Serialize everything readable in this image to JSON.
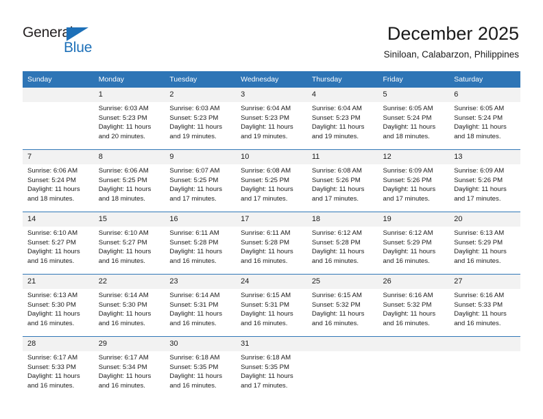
{
  "brand": {
    "name_part1": "General",
    "name_part2": "Blue",
    "accent_color": "#1d70b8"
  },
  "header": {
    "title": "December 2025",
    "subtitle": "Siniloan, Calabarzon, Philippines"
  },
  "theme": {
    "header_row_color": "#2e75b6",
    "daynum_band_color": "#f2f2f2",
    "separator_color": "#2e75b6"
  },
  "weekdays": [
    "Sunday",
    "Monday",
    "Tuesday",
    "Wednesday",
    "Thursday",
    "Friday",
    "Saturday"
  ],
  "weeks": [
    [
      {
        "day": "",
        "sunrise": "",
        "sunset": "",
        "daylight": ""
      },
      {
        "day": "1",
        "sunrise": "Sunrise: 6:03 AM",
        "sunset": "Sunset: 5:23 PM",
        "daylight": "Daylight: 11 hours and 20 minutes."
      },
      {
        "day": "2",
        "sunrise": "Sunrise: 6:03 AM",
        "sunset": "Sunset: 5:23 PM",
        "daylight": "Daylight: 11 hours and 19 minutes."
      },
      {
        "day": "3",
        "sunrise": "Sunrise: 6:04 AM",
        "sunset": "Sunset: 5:23 PM",
        "daylight": "Daylight: 11 hours and 19 minutes."
      },
      {
        "day": "4",
        "sunrise": "Sunrise: 6:04 AM",
        "sunset": "Sunset: 5:23 PM",
        "daylight": "Daylight: 11 hours and 19 minutes."
      },
      {
        "day": "5",
        "sunrise": "Sunrise: 6:05 AM",
        "sunset": "Sunset: 5:24 PM",
        "daylight": "Daylight: 11 hours and 18 minutes."
      },
      {
        "day": "6",
        "sunrise": "Sunrise: 6:05 AM",
        "sunset": "Sunset: 5:24 PM",
        "daylight": "Daylight: 11 hours and 18 minutes."
      }
    ],
    [
      {
        "day": "7",
        "sunrise": "Sunrise: 6:06 AM",
        "sunset": "Sunset: 5:24 PM",
        "daylight": "Daylight: 11 hours and 18 minutes."
      },
      {
        "day": "8",
        "sunrise": "Sunrise: 6:06 AM",
        "sunset": "Sunset: 5:25 PM",
        "daylight": "Daylight: 11 hours and 18 minutes."
      },
      {
        "day": "9",
        "sunrise": "Sunrise: 6:07 AM",
        "sunset": "Sunset: 5:25 PM",
        "daylight": "Daylight: 11 hours and 17 minutes."
      },
      {
        "day": "10",
        "sunrise": "Sunrise: 6:08 AM",
        "sunset": "Sunset: 5:25 PM",
        "daylight": "Daylight: 11 hours and 17 minutes."
      },
      {
        "day": "11",
        "sunrise": "Sunrise: 6:08 AM",
        "sunset": "Sunset: 5:26 PM",
        "daylight": "Daylight: 11 hours and 17 minutes."
      },
      {
        "day": "12",
        "sunrise": "Sunrise: 6:09 AM",
        "sunset": "Sunset: 5:26 PM",
        "daylight": "Daylight: 11 hours and 17 minutes."
      },
      {
        "day": "13",
        "sunrise": "Sunrise: 6:09 AM",
        "sunset": "Sunset: 5:26 PM",
        "daylight": "Daylight: 11 hours and 17 minutes."
      }
    ],
    [
      {
        "day": "14",
        "sunrise": "Sunrise: 6:10 AM",
        "sunset": "Sunset: 5:27 PM",
        "daylight": "Daylight: 11 hours and 16 minutes."
      },
      {
        "day": "15",
        "sunrise": "Sunrise: 6:10 AM",
        "sunset": "Sunset: 5:27 PM",
        "daylight": "Daylight: 11 hours and 16 minutes."
      },
      {
        "day": "16",
        "sunrise": "Sunrise: 6:11 AM",
        "sunset": "Sunset: 5:28 PM",
        "daylight": "Daylight: 11 hours and 16 minutes."
      },
      {
        "day": "17",
        "sunrise": "Sunrise: 6:11 AM",
        "sunset": "Sunset: 5:28 PM",
        "daylight": "Daylight: 11 hours and 16 minutes."
      },
      {
        "day": "18",
        "sunrise": "Sunrise: 6:12 AM",
        "sunset": "Sunset: 5:28 PM",
        "daylight": "Daylight: 11 hours and 16 minutes."
      },
      {
        "day": "19",
        "sunrise": "Sunrise: 6:12 AM",
        "sunset": "Sunset: 5:29 PM",
        "daylight": "Daylight: 11 hours and 16 minutes."
      },
      {
        "day": "20",
        "sunrise": "Sunrise: 6:13 AM",
        "sunset": "Sunset: 5:29 PM",
        "daylight": "Daylight: 11 hours and 16 minutes."
      }
    ],
    [
      {
        "day": "21",
        "sunrise": "Sunrise: 6:13 AM",
        "sunset": "Sunset: 5:30 PM",
        "daylight": "Daylight: 11 hours and 16 minutes."
      },
      {
        "day": "22",
        "sunrise": "Sunrise: 6:14 AM",
        "sunset": "Sunset: 5:30 PM",
        "daylight": "Daylight: 11 hours and 16 minutes."
      },
      {
        "day": "23",
        "sunrise": "Sunrise: 6:14 AM",
        "sunset": "Sunset: 5:31 PM",
        "daylight": "Daylight: 11 hours and 16 minutes."
      },
      {
        "day": "24",
        "sunrise": "Sunrise: 6:15 AM",
        "sunset": "Sunset: 5:31 PM",
        "daylight": "Daylight: 11 hours and 16 minutes."
      },
      {
        "day": "25",
        "sunrise": "Sunrise: 6:15 AM",
        "sunset": "Sunset: 5:32 PM",
        "daylight": "Daylight: 11 hours and 16 minutes."
      },
      {
        "day": "26",
        "sunrise": "Sunrise: 6:16 AM",
        "sunset": "Sunset: 5:32 PM",
        "daylight": "Daylight: 11 hours and 16 minutes."
      },
      {
        "day": "27",
        "sunrise": "Sunrise: 6:16 AM",
        "sunset": "Sunset: 5:33 PM",
        "daylight": "Daylight: 11 hours and 16 minutes."
      }
    ],
    [
      {
        "day": "28",
        "sunrise": "Sunrise: 6:17 AM",
        "sunset": "Sunset: 5:33 PM",
        "daylight": "Daylight: 11 hours and 16 minutes."
      },
      {
        "day": "29",
        "sunrise": "Sunrise: 6:17 AM",
        "sunset": "Sunset: 5:34 PM",
        "daylight": "Daylight: 11 hours and 16 minutes."
      },
      {
        "day": "30",
        "sunrise": "Sunrise: 6:18 AM",
        "sunset": "Sunset: 5:35 PM",
        "daylight": "Daylight: 11 hours and 16 minutes."
      },
      {
        "day": "31",
        "sunrise": "Sunrise: 6:18 AM",
        "sunset": "Sunset: 5:35 PM",
        "daylight": "Daylight: 11 hours and 17 minutes."
      },
      {
        "day": "",
        "sunrise": "",
        "sunset": "",
        "daylight": ""
      },
      {
        "day": "",
        "sunrise": "",
        "sunset": "",
        "daylight": ""
      },
      {
        "day": "",
        "sunrise": "",
        "sunset": "",
        "daylight": ""
      }
    ]
  ]
}
